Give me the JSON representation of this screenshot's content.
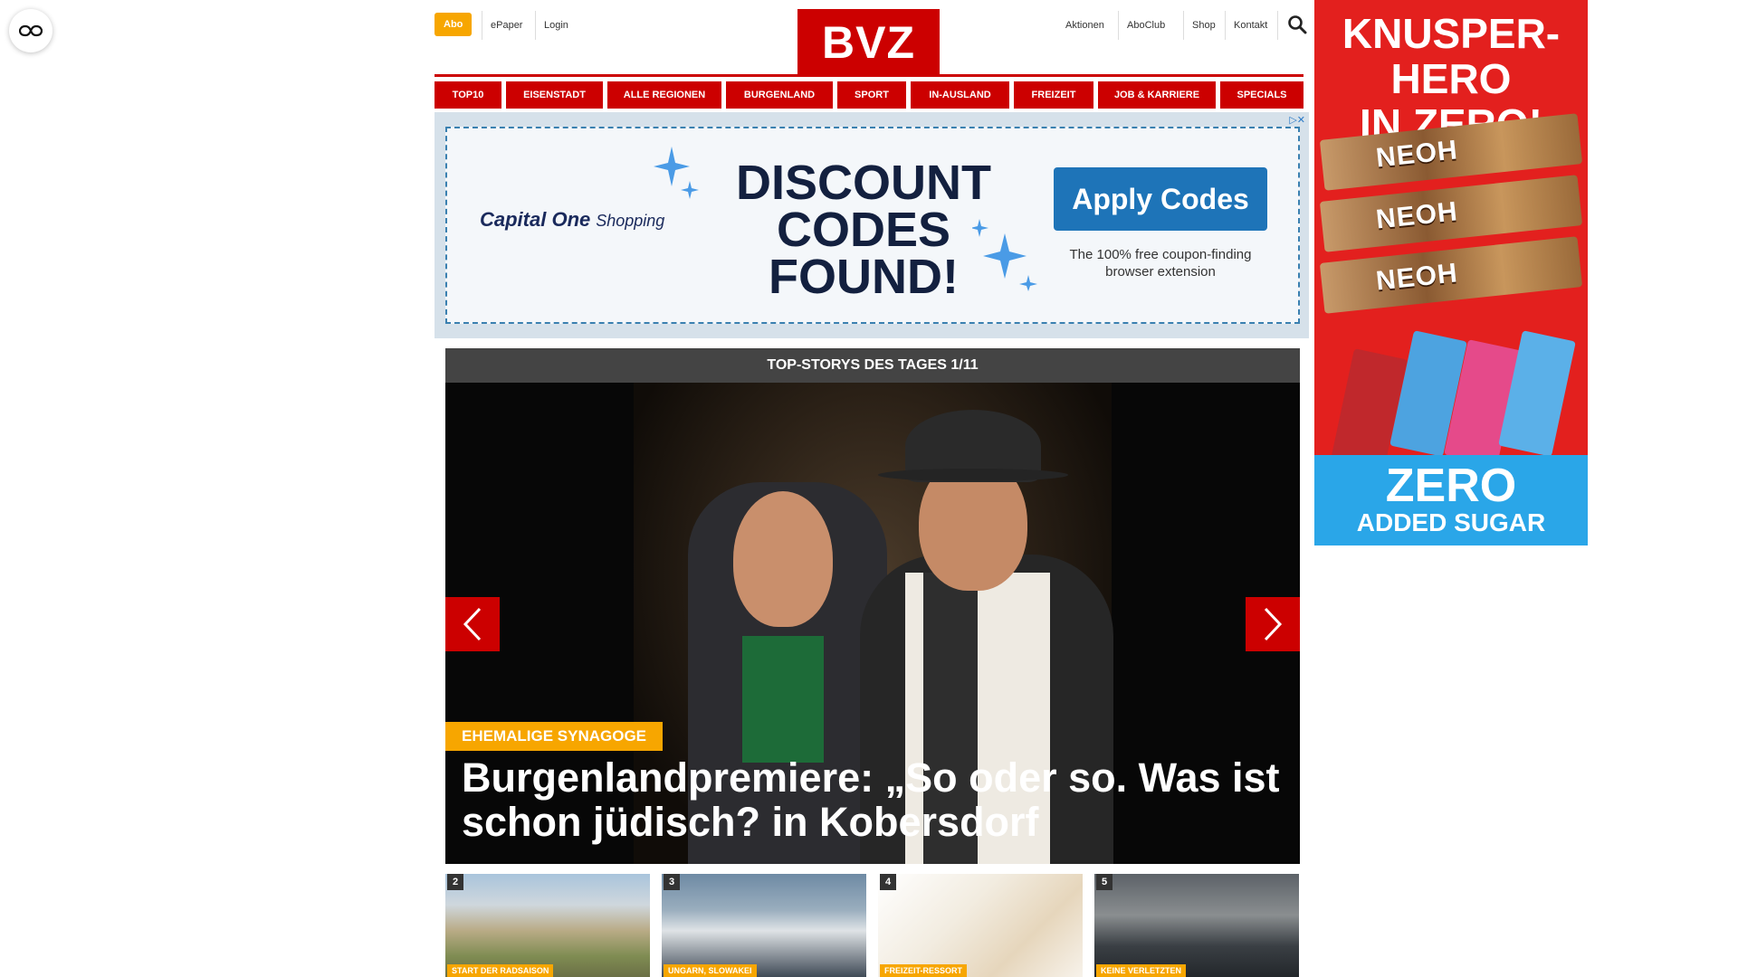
{
  "header": {
    "abo_label": "Abo",
    "links": [
      "ePaper",
      "Login"
    ],
    "right_links": [
      "Aktionen",
      "AboClub",
      "Shop",
      "Kontakt"
    ],
    "logo_text": "BVZ",
    "brand_color": "#cc0000",
    "accent_color": "#f7a600"
  },
  "nav": {
    "items": [
      "TOP10",
      "EISENSTADT",
      "ALLE REGIONEN",
      "BURGENLAND",
      "SPORT",
      "IN-AUSLAND",
      "FREIZEIT",
      "JOB & KARRIERE",
      "SPECIALS"
    ]
  },
  "ad_banner": {
    "brand": "Capital One",
    "brand_suffix": "Shopping",
    "headline": "DISCOUNT CODES FOUND!",
    "cta_label": "Apply Codes",
    "subtext": "The 100% free coupon-finding browser extension"
  },
  "top_stories": {
    "header": "TOP-STORYS DES TAGES 1/11",
    "hero": {
      "tag": "EHEMALIGE SYNAGOGE",
      "title": "Burgenlandpremiere: „So oder so. Was ist schon jüdisch? in Kobersdorf"
    },
    "thumbnails": [
      {
        "num": "2",
        "tag": "START DER RADSAISON"
      },
      {
        "num": "3",
        "tag": "UNGARN, SLOWAKEI"
      },
      {
        "num": "4",
        "tag": "FREIZEIT-RESSORT"
      },
      {
        "num": "5",
        "tag": "KEINE VERLETZTEN"
      }
    ]
  },
  "side_ad": {
    "headline_line1": "KNUSPER-HERO",
    "headline_line2": "IN ZERO!",
    "bar_label": "NEOH",
    "footer_line1": "ZERO",
    "footer_line2": "ADDED SUGAR"
  }
}
